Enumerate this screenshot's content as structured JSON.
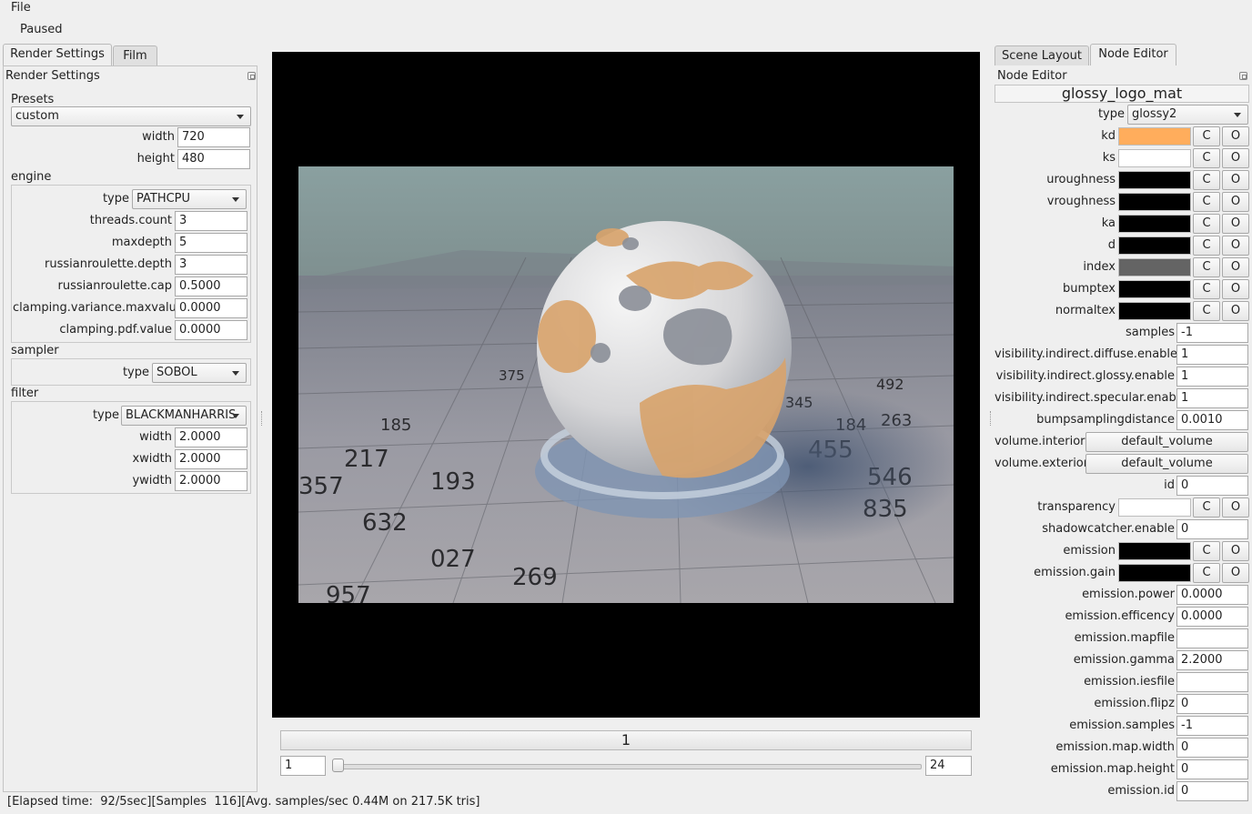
{
  "menu": {
    "file": "File"
  },
  "toolbar": {
    "status": "Paused"
  },
  "left": {
    "tabs": [
      "Render Settings",
      "Film"
    ],
    "panel_title": "Render Settings",
    "presets": {
      "label": "Presets",
      "value": "custom"
    },
    "width": {
      "label": "width",
      "value": "720"
    },
    "height": {
      "label": "height",
      "value": "480"
    },
    "engine": {
      "label": "engine",
      "type": {
        "label": "type",
        "value": "PATHCPU"
      },
      "rows": [
        {
          "label": "threads.count",
          "value": "3"
        },
        {
          "label": "maxdepth",
          "value": "5"
        },
        {
          "label": "russianroulette.depth",
          "value": "3"
        },
        {
          "label": "russianroulette.cap",
          "value": "0.5000"
        },
        {
          "label": "clamping.variance.maxvalue",
          "value": "0.0000"
        },
        {
          "label": "clamping.pdf.value",
          "value": "0.0000"
        }
      ]
    },
    "sampler": {
      "label": "sampler",
      "type": {
        "label": "type",
        "value": "SOBOL"
      }
    },
    "filter": {
      "label": "filter",
      "type": {
        "label": "type",
        "value": "BLACKMANHARRIS"
      },
      "rows": [
        {
          "label": "width",
          "value": "2.0000"
        },
        {
          "label": "xwidth",
          "value": "2.0000"
        },
        {
          "label": "ywidth",
          "value": "2.0000"
        }
      ]
    }
  },
  "viewport": {
    "grid_numbers": [
      "357",
      "217",
      "193",
      "632",
      "027",
      "269",
      "185",
      "455",
      "546",
      "835",
      "345",
      "492",
      "184",
      "263",
      "375",
      "957"
    ]
  },
  "timeline": {
    "frame": "1",
    "start": "1",
    "end": "24",
    "position": 0
  },
  "statusbar": {
    "text": "[Elapsed time:  92/5sec][Samples  116][Avg. samples/sec 0.44M on 217.5K tris]"
  },
  "right": {
    "tabs": [
      "Scene Layout",
      "Node Editor"
    ],
    "panel_title": "Node Editor",
    "material_name": "glossy_logo_mat",
    "type": {
      "label": "type",
      "value": "glossy2"
    },
    "button_c": "C",
    "button_o": "O",
    "color_rows": [
      {
        "label": "kd",
        "color": "#ffad5c"
      },
      {
        "label": "ks",
        "color": "#ffffff"
      },
      {
        "label": "uroughness",
        "color": "#000000"
      },
      {
        "label": "vroughness",
        "color": "#000000"
      },
      {
        "label": "ka",
        "color": "#000000"
      },
      {
        "label": "d",
        "color": "#000000"
      },
      {
        "label": "index",
        "color": "#646464"
      },
      {
        "label": "bumptex",
        "color": "#000000"
      },
      {
        "label": "normaltex",
        "color": "#000000"
      }
    ],
    "value_rows": [
      {
        "label": "samples",
        "value": "-1"
      },
      {
        "label": "visibility.indirect.diffuse.enable",
        "value": "1"
      },
      {
        "label": "visibility.indirect.glossy.enable",
        "value": "1"
      },
      {
        "label": "visibility.indirect.specular.enable",
        "value": "1"
      },
      {
        "label": "bumpsamplingdistance",
        "value": "0.0010"
      }
    ],
    "volume_interior": {
      "label": "volume.interior",
      "value": "default_volume"
    },
    "volume_exterior": {
      "label": "volume.exterior",
      "value": "default_volume"
    },
    "id": {
      "label": "id",
      "value": "0"
    },
    "transparency": {
      "label": "transparency",
      "color": "#ffffff"
    },
    "shadowcatcher": {
      "label": "shadowcatcher.enable",
      "value": "0"
    },
    "emission": {
      "label": "emission",
      "color": "#000000"
    },
    "emission_gain": {
      "label": "emission.gain",
      "color": "#000000"
    },
    "emission_rows": [
      {
        "label": "emission.power",
        "value": "0.0000"
      },
      {
        "label": "emission.efficency",
        "value": "0.0000"
      },
      {
        "label": "emission.mapfile",
        "value": ""
      },
      {
        "label": "emission.gamma",
        "value": "2.2000"
      },
      {
        "label": "emission.iesfile",
        "value": ""
      },
      {
        "label": "emission.flipz",
        "value": "0"
      },
      {
        "label": "emission.samples",
        "value": "-1"
      },
      {
        "label": "emission.map.width",
        "value": "0"
      },
      {
        "label": "emission.map.height",
        "value": "0"
      },
      {
        "label": "emission.id",
        "value": "0"
      }
    ]
  }
}
